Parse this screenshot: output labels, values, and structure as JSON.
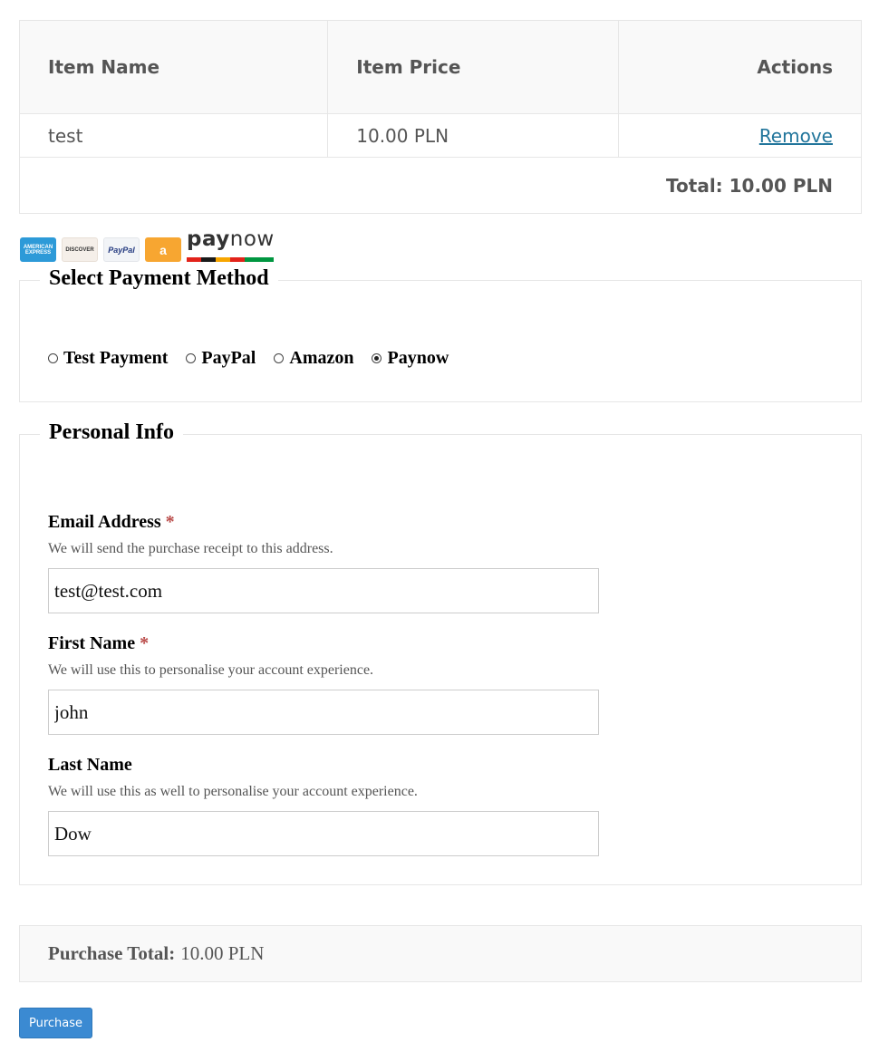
{
  "cart": {
    "headers": {
      "item_name": "Item Name",
      "item_price": "Item Price",
      "actions": "Actions"
    },
    "items": [
      {
        "name": "test",
        "price": "10.00 PLN",
        "action": "Remove"
      }
    ],
    "total": "Total: 10.00 PLN"
  },
  "payment_logos": {
    "amex": "AMERICAN EXPRESS",
    "discover": "DISCOVER",
    "paypal": "PayPal",
    "amazon": "a",
    "paynow_pay": "pay",
    "paynow_now": "now",
    "paynow_bar_colors": [
      "#e2231a",
      "#1a1a1a",
      "#f7a600",
      "#e2231a",
      "#009640",
      "#009640"
    ]
  },
  "payment_method": {
    "legend": "Select Payment Method",
    "options": [
      {
        "label": "Test Payment",
        "checked": false
      },
      {
        "label": "PayPal",
        "checked": false
      },
      {
        "label": "Amazon",
        "checked": false
      },
      {
        "label": "Paynow",
        "checked": true
      }
    ]
  },
  "personal_info": {
    "legend": "Personal Info",
    "email": {
      "label": "Email Address",
      "required": "*",
      "description": "We will send the purchase receipt to this address.",
      "value": "test@test.com"
    },
    "first_name": {
      "label": "First Name",
      "required": "*",
      "description": "We will use this to personalise your account experience.",
      "value": "john"
    },
    "last_name": {
      "label": "Last Name",
      "description": "We will use this as well to personalise your account experience.",
      "value": "Dow"
    }
  },
  "purchase_total": {
    "label": "Purchase Total:",
    "value": "10.00 PLN"
  },
  "purchase_button": "Purchase",
  "colors": {
    "link": "#21759b",
    "button": "#3b8ad2",
    "required": "#b94a48",
    "border": "#e6e6e6"
  }
}
